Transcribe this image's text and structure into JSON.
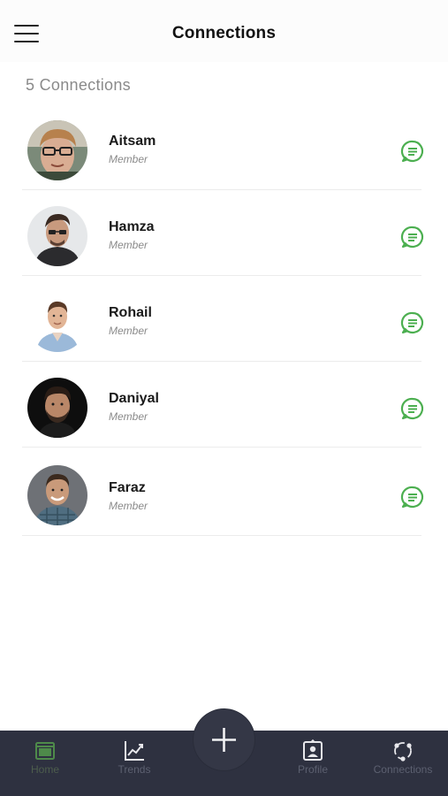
{
  "header": {
    "title": "Connections"
  },
  "summary": {
    "count_label": "5 Connections"
  },
  "connections": [
    {
      "name": "Aitsam",
      "role": "Member"
    },
    {
      "name": "Hamza",
      "role": "Member"
    },
    {
      "name": "Rohail",
      "role": "Member"
    },
    {
      "name": "Daniyal",
      "role": "Member"
    },
    {
      "name": "Faraz",
      "role": "Member"
    }
  ],
  "bottom_nav": {
    "items": [
      {
        "label": "Home",
        "icon": "home-window-icon",
        "active": true
      },
      {
        "label": "Trends",
        "icon": "trend-chart-icon"
      },
      {
        "label": "Profile",
        "icon": "profile-badge-icon"
      },
      {
        "label": "Connections",
        "icon": "connections-network-icon"
      }
    ],
    "fab_icon": "plus-icon"
  },
  "colors": {
    "accent_green": "#4caf50",
    "nav_background": "#2e3140",
    "nav_label": "#5c6070"
  }
}
